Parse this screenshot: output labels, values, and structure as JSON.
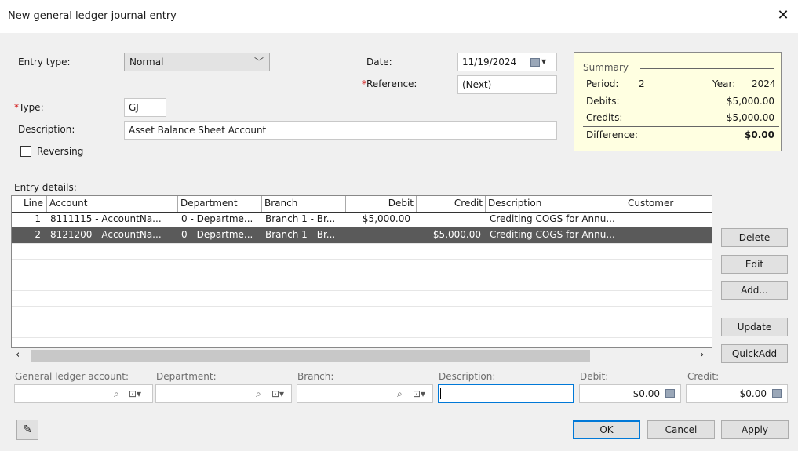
{
  "window": {
    "title": "New general ledger journal entry",
    "close_glyph": "✕"
  },
  "form": {
    "entry_type_label": "Entry type:",
    "entry_type_value": "Normal",
    "date_label": "Date:",
    "date_value": "11/19/2024",
    "reference_req": "*",
    "reference_label": "Reference:",
    "reference_value": "(Next)",
    "type_req": "*",
    "type_label": "Type:",
    "type_value": "GJ",
    "description_label": "Description:",
    "description_value": "Asset Balance Sheet Account",
    "reversing_label": "Reversing"
  },
  "summary": {
    "heading": "Summary",
    "period_label": "Period:",
    "period_value": "2",
    "year_label": "Year:",
    "year_value": "2024",
    "debits_label": "Debits:",
    "debits_value": "$5,000.00",
    "credits_label": "Credits:",
    "credits_value": "$5,000.00",
    "difference_label": "Difference:",
    "difference_value": "$0.00"
  },
  "entry_details": {
    "label": "Entry details:",
    "columns": [
      "Line",
      "Account",
      "Department",
      "Branch",
      "Debit",
      "Credit",
      "Description",
      "Customer"
    ],
    "rows": [
      {
        "line": "1",
        "account": "8111115 - AccountNa...",
        "department": "0 - Departme...",
        "branch": "Branch 1 - Br...",
        "debit": "$5,000.00",
        "credit": "",
        "description": "Crediting COGS for Annu...",
        "customer": ""
      },
      {
        "line": "2",
        "account": "8121200 - AccountNa...",
        "department": "0 - Departme...",
        "branch": "Branch 1 - Br...",
        "debit": "",
        "credit": "$5,000.00",
        "description": "Crediting COGS for Annu...",
        "customer": ""
      }
    ],
    "selected_row": 2
  },
  "side_buttons": {
    "delete": "Delete",
    "edit": "Edit",
    "add": "Add...",
    "update": "Update",
    "quickadd": "QuickAdd"
  },
  "line_fields": {
    "gl_account_label": "General ledger account:",
    "department_label": "Department:",
    "branch_label": "Branch:",
    "description_label": "Description:",
    "debit_label": "Debit:",
    "debit_value": "$0.00",
    "credit_label": "Credit:",
    "credit_value": "$0.00"
  },
  "footer": {
    "ok": "OK",
    "cancel": "Cancel",
    "apply": "Apply"
  },
  "colors": {
    "selected_row": "#5a5a5a",
    "summary_bg": "#ffffe1",
    "focus_border": "#0078d7",
    "required": "#d00000"
  }
}
